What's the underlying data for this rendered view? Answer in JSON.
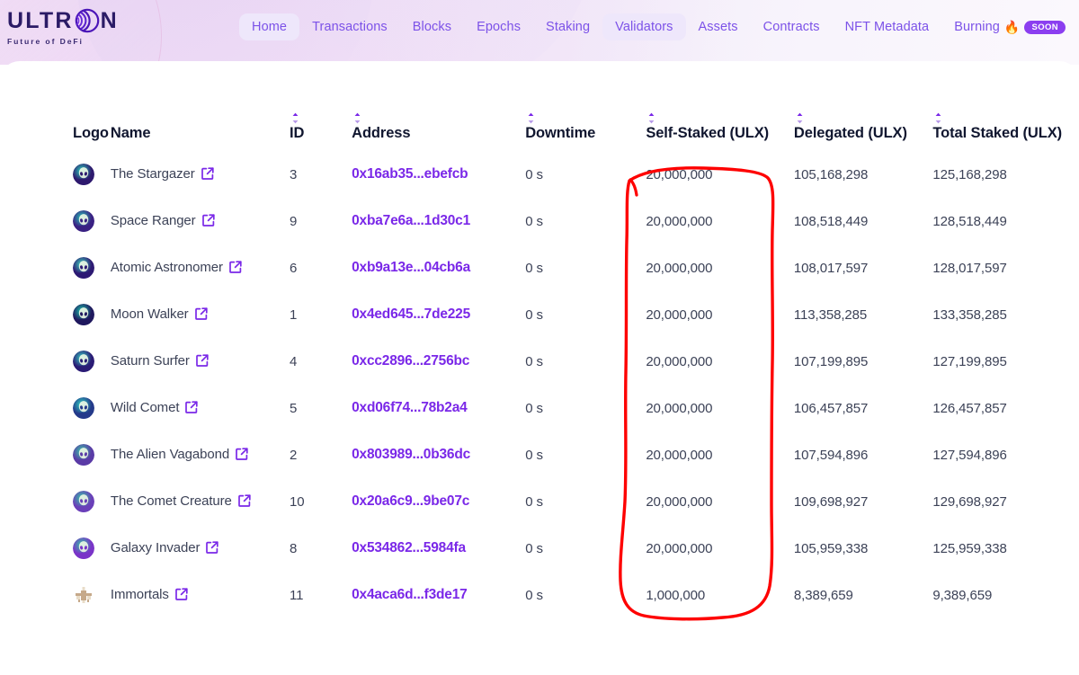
{
  "brand": {
    "name_left": "ULTR",
    "name_right": "N",
    "mark": "ultron-spiral-logo",
    "tagline": "Future of DeFi",
    "accent": "#7c52e8",
    "logo_color": "#2b1b66"
  },
  "nav": {
    "items": [
      {
        "label": "Home",
        "active": true,
        "badge": null,
        "icon": null
      },
      {
        "label": "Transactions",
        "active": false,
        "badge": null,
        "icon": null
      },
      {
        "label": "Blocks",
        "active": false,
        "badge": null,
        "icon": null
      },
      {
        "label": "Epochs",
        "active": false,
        "badge": null,
        "icon": null
      },
      {
        "label": "Staking",
        "active": false,
        "badge": null,
        "icon": null
      },
      {
        "label": "Validators",
        "active": true,
        "badge": null,
        "icon": null
      },
      {
        "label": "Assets",
        "active": false,
        "badge": null,
        "icon": null
      },
      {
        "label": "Contracts",
        "active": false,
        "badge": null,
        "icon": null
      },
      {
        "label": "NFT Metadata",
        "active": false,
        "badge": null,
        "icon": null
      },
      {
        "label": "Burning",
        "active": false,
        "badge": "SOON",
        "icon": "fire-icon"
      }
    ]
  },
  "table": {
    "columns": [
      {
        "key": "logo",
        "label": "Logo",
        "sortable": false
      },
      {
        "key": "name",
        "label": "Name",
        "sortable": false
      },
      {
        "key": "id",
        "label": "ID",
        "sortable": true
      },
      {
        "key": "address",
        "label": "Address",
        "sortable": true
      },
      {
        "key": "downtime",
        "label": "Downtime",
        "sortable": true
      },
      {
        "key": "self",
        "label": "Self-Staked (ULX)",
        "sortable": true
      },
      {
        "key": "delegated",
        "label": "Delegated (ULX)",
        "sortable": true
      },
      {
        "key": "total",
        "label": "Total Staked (ULX)",
        "sortable": true
      }
    ],
    "rows": [
      {
        "avatar": "alien-avatar-teal",
        "avatar_colors": [
          "#2bd6c0",
          "#2e1a6e"
        ],
        "name": "The Stargazer",
        "id": "3",
        "address": "0x16ab35...ebefcb",
        "downtime": "0 s",
        "self_staked": "20,000,000",
        "delegated": "105,168,298",
        "total_staked": "125,168,298"
      },
      {
        "avatar": "alien-avatar-teal",
        "avatar_colors": [
          "#23c9b6",
          "#3a2183"
        ],
        "name": "Space Ranger",
        "id": "9",
        "address": "0xba7e6a...1d30c1",
        "downtime": "0 s",
        "self_staked": "20,000,000",
        "delegated": "108,518,449",
        "total_staked": "128,518,449"
      },
      {
        "avatar": "alien-avatar-teal",
        "avatar_colors": [
          "#3fdcc2",
          "#2d1a73"
        ],
        "name": "Atomic Astronomer",
        "id": "6",
        "address": "0xb9a13e...04cb6a",
        "downtime": "0 s",
        "self_staked": "20,000,000",
        "delegated": "108,017,597",
        "total_staked": "128,017,597"
      },
      {
        "avatar": "alien-avatar-teal",
        "avatar_colors": [
          "#19c7ae",
          "#20195e"
        ],
        "name": "Moon Walker",
        "id": "1",
        "address": "0x4ed645...7de225",
        "downtime": "0 s",
        "self_staked": "20,000,000",
        "delegated": "113,358,285",
        "total_staked": "133,358,285"
      },
      {
        "avatar": "alien-avatar-teal",
        "avatar_colors": [
          "#35d3c4",
          "#2a1b75"
        ],
        "name": "Saturn Surfer",
        "id": "4",
        "address": "0xcc2896...2756bc",
        "downtime": "0 s",
        "self_staked": "20,000,000",
        "delegated": "107,199,895",
        "total_staked": "127,199,895"
      },
      {
        "avatar": "alien-avatar-teal",
        "avatar_colors": [
          "#2fd9c6",
          "#243a8a"
        ],
        "name": "Wild Comet",
        "id": "5",
        "address": "0xd06f74...78b2a4",
        "downtime": "0 s",
        "self_staked": "20,000,000",
        "delegated": "106,457,857",
        "total_staked": "126,457,857"
      },
      {
        "avatar": "alien-avatar-purple",
        "avatar_colors": [
          "#36c9a8",
          "#5a3ba6"
        ],
        "name": "The Alien Vagabond",
        "id": "2",
        "address": "0x803989...0b36dc",
        "downtime": "0 s",
        "self_staked": "20,000,000",
        "delegated": "107,594,896",
        "total_staked": "127,594,896"
      },
      {
        "avatar": "alien-avatar-purple",
        "avatar_colors": [
          "#2fc9a6",
          "#6a3fb8"
        ],
        "name": "The Comet Creature",
        "id": "10",
        "address": "0x20a6c9...9be07c",
        "downtime": "0 s",
        "self_staked": "20,000,000",
        "delegated": "109,698,927",
        "total_staked": "129,698,927"
      },
      {
        "avatar": "alien-avatar-purple",
        "avatar_colors": [
          "#2ec7a4",
          "#7a34c8"
        ],
        "name": "Galaxy Invader",
        "id": "8",
        "address": "0x534862...5984fa",
        "downtime": "0 s",
        "self_staked": "20,000,000",
        "delegated": "105,959,338",
        "total_staked": "125,959,338"
      },
      {
        "avatar": "pixel-moth-icon",
        "avatar_colors": [
          "#c6a98a",
          "#e8dcc8"
        ],
        "name": "Immortals",
        "id": "11",
        "address": "0x4aca6d...f3de17",
        "downtime": "0 s",
        "self_staked": "1,000,000",
        "delegated": "8,389,659",
        "total_staked": "9,389,659"
      }
    ]
  },
  "annotation": {
    "type": "hand-drawn-ellipse",
    "color": "#fe0000",
    "target_column": "Self-Staked (ULX)",
    "encircled_rows": 9
  }
}
